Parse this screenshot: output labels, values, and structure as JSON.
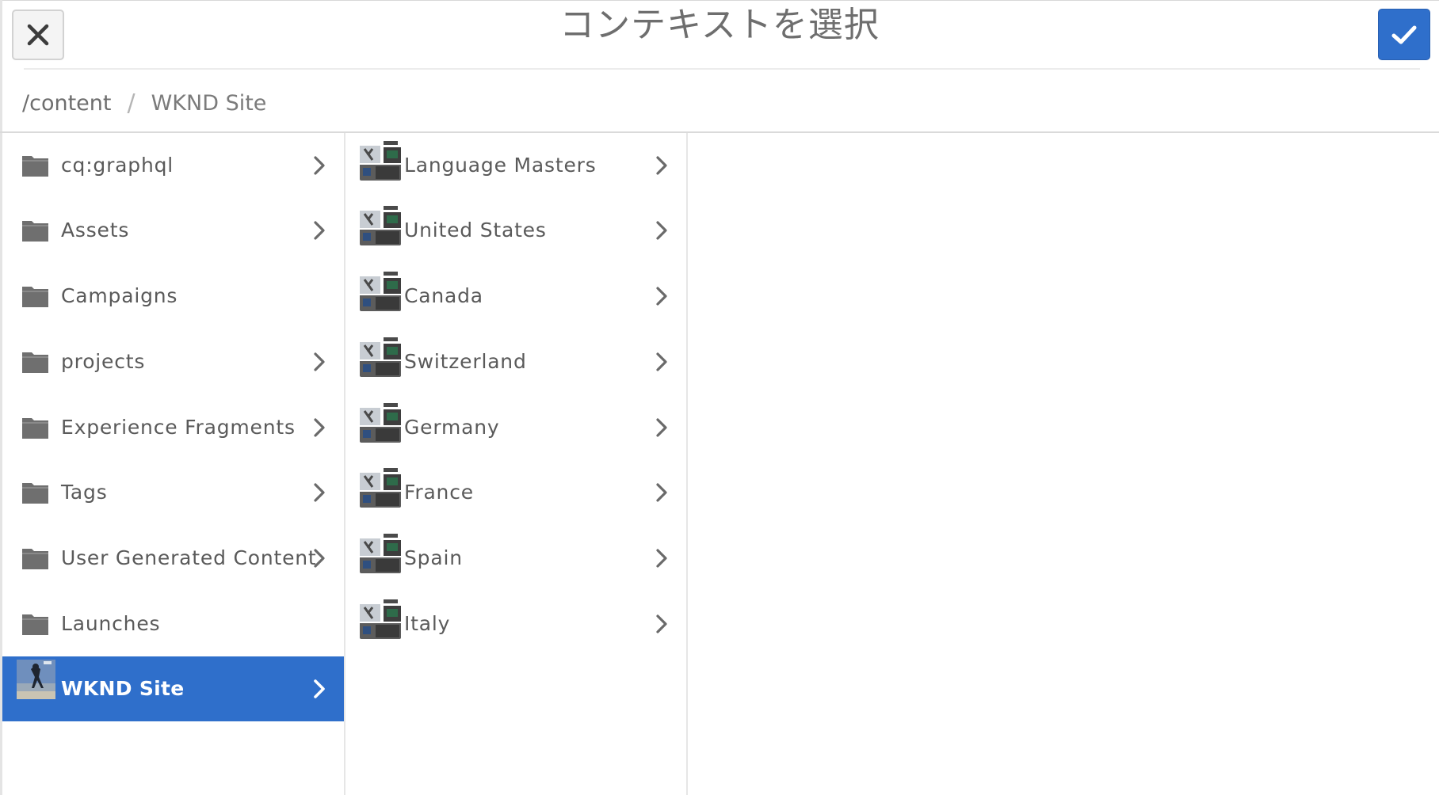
{
  "dialog": {
    "title": "コンテキストを選択",
    "close_label": "Close",
    "confirm_label": "Confirm"
  },
  "breadcrumb": {
    "root": "/content",
    "separator": "/",
    "current": "WKND Site"
  },
  "colors": {
    "accent": "#2f6fcb",
    "text": "#5a5a5a",
    "icon": "#6f6f6f"
  },
  "column1": {
    "items": [
      {
        "label": "cq:graphql",
        "icon": "folder-icon",
        "has_children": true
      },
      {
        "label": "Assets",
        "icon": "folder-icon",
        "has_children": true
      },
      {
        "label": "Campaigns",
        "icon": "folder-icon",
        "has_children": false
      },
      {
        "label": "projects",
        "icon": "folder-icon",
        "has_children": true
      },
      {
        "label": "Experience Fragments",
        "icon": "folder-icon",
        "has_children": true
      },
      {
        "label": "Tags",
        "icon": "folder-icon",
        "has_children": true
      },
      {
        "label": "User Generated Content",
        "icon": "folder-icon",
        "has_children": true
      },
      {
        "label": "Launches",
        "icon": "folder-icon",
        "has_children": false
      },
      {
        "label": "WKND Site",
        "icon": "site-thumbnail",
        "has_children": true,
        "selected": true
      }
    ]
  },
  "column2": {
    "items": [
      {
        "label": "Language Masters",
        "icon": "page-thumbnail",
        "has_children": true
      },
      {
        "label": "United States",
        "icon": "page-thumbnail",
        "has_children": true
      },
      {
        "label": "Canada",
        "icon": "page-thumbnail",
        "has_children": true
      },
      {
        "label": "Switzerland",
        "icon": "page-thumbnail",
        "has_children": true
      },
      {
        "label": "Germany",
        "icon": "page-thumbnail",
        "has_children": true
      },
      {
        "label": "France",
        "icon": "page-thumbnail",
        "has_children": true
      },
      {
        "label": "Spain",
        "icon": "page-thumbnail",
        "has_children": true
      },
      {
        "label": "Italy",
        "icon": "page-thumbnail",
        "has_children": true
      }
    ]
  }
}
